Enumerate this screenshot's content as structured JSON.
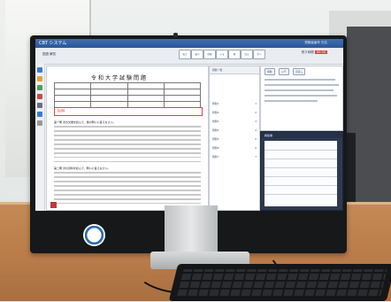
{
  "app": {
    "title": "CBT システム",
    "user_info": "受験者番号 氏名",
    "breadcrumb": "国語 解答",
    "timer_label": "残り時間",
    "timer_value": "00:30"
  },
  "toolbar": {
    "buttons": [
      "拡大",
      "縮小",
      "印刷",
      "メモ",
      "線",
      "戻る",
      "次へ"
    ]
  },
  "document": {
    "title": "令和大学試験問題",
    "section_1": "第一問 次の文章を読んで、後の問いに答えなさい。",
    "section_2": "第二問 次の資料を読んで、問いに答えなさい。",
    "note": "【注意】"
  },
  "question_list": {
    "header": "問題一覧",
    "items": [
      {
        "label": "問題1",
        "num": "1"
      },
      {
        "label": "問題2",
        "num": "2"
      },
      {
        "label": "問題3",
        "num": "3"
      },
      {
        "label": "問題4",
        "num": "4"
      },
      {
        "label": "問題5",
        "num": "5"
      },
      {
        "label": "問題6",
        "num": "6"
      },
      {
        "label": "問題7",
        "num": "7"
      }
    ]
  },
  "question_panel": {
    "tabs": [
      "問題",
      "メモ",
      "見直し"
    ]
  },
  "answer_panel": {
    "label": "解答欄"
  },
  "colors": {
    "titlebar": "#2c5696",
    "answer_panel": "#2d3a4f",
    "desk": "#b87b49",
    "highlight_red": "#d44444"
  }
}
